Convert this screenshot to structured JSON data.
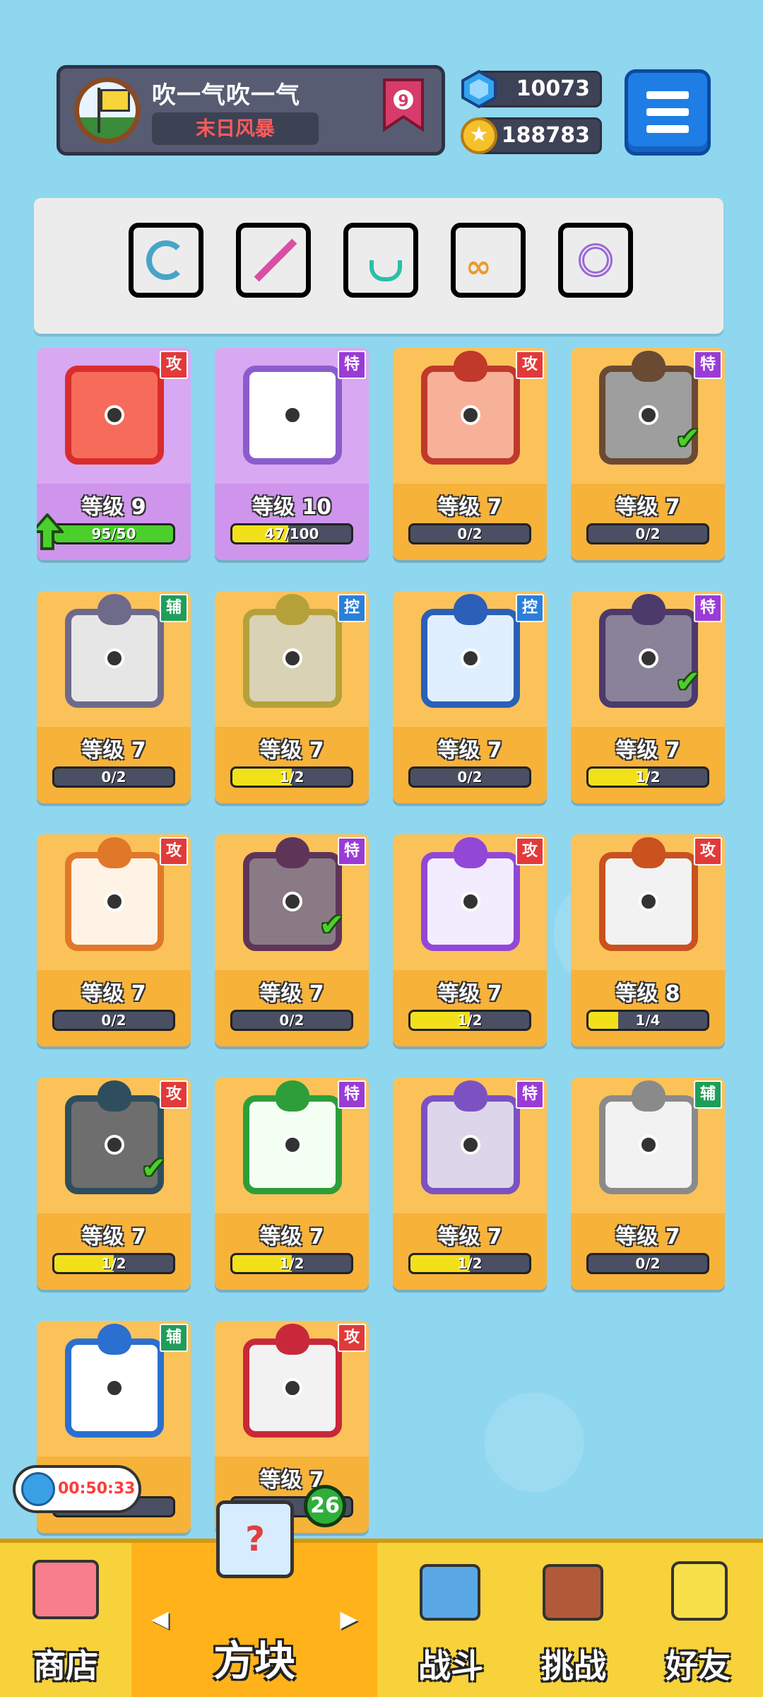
{
  "player": {
    "name": "吹一气吹一气",
    "title": "末日风暴",
    "rank": "9"
  },
  "currency": {
    "gems": "10073",
    "coins": "188783"
  },
  "deck": [
    {
      "name": "tornado-dice-icon",
      "color": "#4aa3c8"
    },
    {
      "name": "sword-dice-icon",
      "color": "#d94fa3"
    },
    {
      "name": "healing-dice-icon",
      "color": "#2bbfa8"
    },
    {
      "name": "infinity-dice-icon",
      "color": "#e89c2a"
    },
    {
      "name": "vortex-dice-icon",
      "color": "#9b67d8"
    }
  ],
  "cards": [
    {
      "name": "fire-dice",
      "level": "等级 9",
      "tag": "攻",
      "tag_color": "#e23a3a",
      "progress": "95/50",
      "fill": 1.0,
      "fill_color": "#4ccf2c",
      "bg": "#d9a8f2",
      "frame": "#d92c2c",
      "face": "#f76b5a",
      "upgrade": true
    },
    {
      "name": "shatter-dice",
      "level": "等级 10",
      "tag": "特",
      "tag_color": "#9a3bd6",
      "progress": "47/100",
      "fill": 0.47,
      "fill_color": "#f2e11a",
      "bg": "#d9a8f2",
      "frame": "#8b5ccc",
      "face": "#ffffff"
    },
    {
      "name": "flame-star-dice",
      "level": "等级 7",
      "tag": "攻",
      "tag_color": "#e23a3a",
      "progress": "0/2",
      "fill": 0,
      "fill_color": "#f2e11a",
      "bg": "#fbc25a",
      "frame": "#c0392b",
      "face": "#f7b199"
    },
    {
      "name": "infinity-dice",
      "level": "等级 7",
      "tag": "特",
      "tag_color": "#9a3bd6",
      "progress": "0/2",
      "fill": 0,
      "fill_color": "#f2e11a",
      "bg": "#fbc25a",
      "frame": "#6b4a33",
      "face": "#9e9e9e",
      "checked": true
    },
    {
      "name": "crusher-dice",
      "level": "等级 7",
      "tag": "辅",
      "tag_color": "#1f9e5a",
      "progress": "0/2",
      "fill": 0,
      "fill_color": "#f2e11a",
      "bg": "#fbc25a",
      "frame": "#6e6a8a",
      "face": "#e6e6e6"
    },
    {
      "name": "target-dice",
      "level": "等级 7",
      "tag": "控",
      "tag_color": "#2b7fd9",
      "progress": "1/2",
      "fill": 0.5,
      "fill_color": "#f2e11a",
      "bg": "#fbc25a",
      "frame": "#b5a13a",
      "face": "#d9d2b4"
    },
    {
      "name": "ice-dice",
      "level": "等级 7",
      "tag": "控",
      "tag_color": "#2b7fd9",
      "progress": "0/2",
      "fill": 0,
      "fill_color": "#f2e11a",
      "bg": "#fbc25a",
      "frame": "#2b5fb8",
      "face": "#dfefff"
    },
    {
      "name": "shadow-dice",
      "level": "等级 7",
      "tag": "特",
      "tag_color": "#9a3bd6",
      "progress": "1/2",
      "fill": 0.5,
      "fill_color": "#f2e11a",
      "bg": "#fbc25a",
      "frame": "#4c3a6b",
      "face": "#8a8299",
      "checked": true
    },
    {
      "name": "blaze-dice",
      "level": "等级 7",
      "tag": "攻",
      "tag_color": "#e23a3a",
      "progress": "0/2",
      "fill": 0,
      "fill_color": "#f2e11a",
      "bg": "#fbc25a",
      "frame": "#e0782a",
      "face": "#fff3e6"
    },
    {
      "name": "cross-dice",
      "level": "等级 7",
      "tag": "特",
      "tag_color": "#9a3bd6",
      "progress": "0/2",
      "fill": 0,
      "fill_color": "#f2e11a",
      "bg": "#fbc25a",
      "frame": "#5e3559",
      "face": "#8a7a85",
      "checked": true
    },
    {
      "name": "orbit-dice",
      "level": "等级 7",
      "tag": "攻",
      "tag_color": "#e23a3a",
      "progress": "1/2",
      "fill": 0.5,
      "fill_color": "#f2e11a",
      "bg": "#fbc25a",
      "frame": "#9347d6",
      "face": "#f3ecff"
    },
    {
      "name": "gun-dice",
      "level": "等级 8",
      "tag": "攻",
      "tag_color": "#e23a3a",
      "progress": "1/4",
      "fill": 0.25,
      "fill_color": "#f2e11a",
      "bg": "#fbc25a",
      "frame": "#c9521f",
      "face": "#f2f2f2"
    },
    {
      "name": "black-hole-dice",
      "level": "等级 7",
      "tag": "攻",
      "tag_color": "#e23a3a",
      "progress": "1/2",
      "fill": 0.5,
      "fill_color": "#f2e11a",
      "bg": "#fbc25a",
      "frame": "#2e4e5e",
      "face": "#6e6e6e",
      "checked": true
    },
    {
      "name": "wind-dice",
      "level": "等级 7",
      "tag": "特",
      "tag_color": "#9a3bd6",
      "progress": "1/2",
      "fill": 0.5,
      "fill_color": "#f2e11a",
      "bg": "#fbc25a",
      "frame": "#2e9e3a",
      "face": "#f2fff2"
    },
    {
      "name": "mist-dice",
      "level": "等级 7",
      "tag": "特",
      "tag_color": "#9a3bd6",
      "progress": "1/2",
      "fill": 0.5,
      "fill_color": "#f2e11a",
      "bg": "#fbc25a",
      "frame": "#7c52c2",
      "face": "#ddd6ea"
    },
    {
      "name": "time-dice",
      "level": "等级 7",
      "tag": "辅",
      "tag_color": "#1f9e5a",
      "progress": "0/2",
      "fill": 0,
      "fill_color": "#f2e11a",
      "bg": "#fbc25a",
      "frame": "#8a8a8a",
      "face": "#f2f2f2"
    },
    {
      "name": "moon-dice",
      "level": "",
      "tag": "辅",
      "tag_color": "#1f9e5a",
      "progress": "",
      "fill": 0,
      "fill_color": "#f2e11a",
      "bg": "#fbc25a",
      "frame": "#2b6fd0",
      "face": "#ffffff"
    },
    {
      "name": "saw-dice",
      "level": "等级 7",
      "tag": "攻",
      "tag_color": "#e23a3a",
      "progress": "",
      "fill": 0,
      "fill_color": "#f2e11a",
      "bg": "#fbc25a",
      "frame": "#c8283a",
      "face": "#f2f2f2"
    }
  ],
  "timer": "00:50:33",
  "box_count": "26",
  "nav": {
    "shop": "商店",
    "dice": "方块",
    "battle": "战斗",
    "challenge": "挑战",
    "friends": "好友"
  }
}
